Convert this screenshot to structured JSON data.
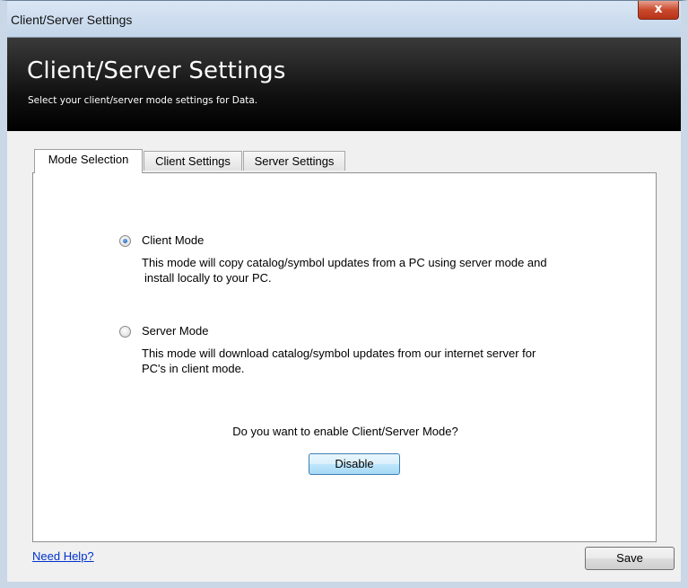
{
  "window": {
    "title": "Client/Server Settings",
    "close_glyph": "x"
  },
  "banner": {
    "title": "Client/Server Settings",
    "subtitle": "Select your client/server mode settings for Data."
  },
  "tabs": [
    {
      "label": "Mode Selection",
      "active": true
    },
    {
      "label": "Client Settings",
      "active": false
    },
    {
      "label": "Server Settings",
      "active": false
    }
  ],
  "options": {
    "client": {
      "label": "Client Mode",
      "selected": true,
      "desc_line1": "This mode will copy catalog/symbol updates from a PC using server mode and",
      "desc_line2": "install locally to your PC."
    },
    "server": {
      "label": "Server Mode",
      "selected": false,
      "desc_line1": "This mode will download catalog/symbol updates from our internet server for",
      "desc_line2": "PC's in client mode."
    }
  },
  "question": "Do you want to enable Client/Server Mode?",
  "buttons": {
    "toggle_label": "Disable",
    "save_label": "Save"
  },
  "help_link": "Need Help?"
}
